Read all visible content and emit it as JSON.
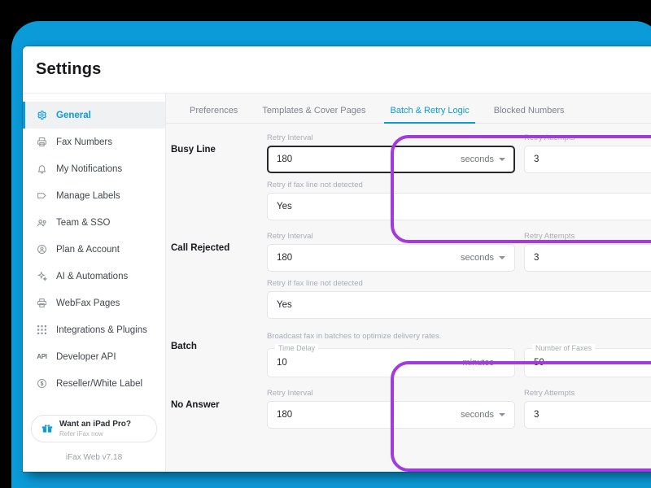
{
  "window": {
    "title": "Settings"
  },
  "sidebar": {
    "items": [
      {
        "label": "General",
        "icon": "gear-icon",
        "active": true
      },
      {
        "label": "Fax Numbers",
        "icon": "fax-icon",
        "active": false
      },
      {
        "label": "My Notifications",
        "icon": "bell-icon",
        "active": false
      },
      {
        "label": "Manage Labels",
        "icon": "tag-icon",
        "active": false
      },
      {
        "label": "Team & SSO",
        "icon": "people-icon",
        "active": false
      },
      {
        "label": "Plan & Account",
        "icon": "user-circle-icon",
        "active": false
      },
      {
        "label": "AI & Automations",
        "icon": "sparkle-icon",
        "active": false
      },
      {
        "label": "WebFax Pages",
        "icon": "printer-icon",
        "active": false
      },
      {
        "label": "Integrations & Plugins",
        "icon": "grid-dots-icon",
        "active": false
      },
      {
        "label": "Developer API",
        "icon": "api-icon",
        "active": false
      },
      {
        "label": "Reseller/White Label",
        "icon": "dollar-circle-icon",
        "active": false
      }
    ],
    "promo": {
      "icon": "gift-icon",
      "title": "Want an iPad Pro?",
      "subtitle": "Refer iFax now"
    },
    "version": "iFax Web v7.18"
  },
  "tabs": [
    {
      "label": "Preferences",
      "active": false
    },
    {
      "label": "Templates & Cover Pages",
      "active": false
    },
    {
      "label": "Batch & Retry Logic",
      "active": true
    },
    {
      "label": "Blocked Numbers",
      "active": false
    }
  ],
  "sections": {
    "busy_line": {
      "label": "Busy Line",
      "retry_interval_label": "Retry Interval",
      "retry_interval_value": "180",
      "retry_interval_unit": "seconds",
      "retry_attempts_label": "Retry Attempts",
      "retry_attempts_value": "3",
      "fax_detect_label": "Retry if fax line not detected",
      "fax_detect_value": "Yes"
    },
    "call_rejected": {
      "label": "Call Rejected",
      "retry_interval_label": "Retry Interval",
      "retry_interval_value": "180",
      "retry_interval_unit": "seconds",
      "retry_attempts_label": "Retry Attempts",
      "retry_attempts_value": "3",
      "fax_detect_label": "Retry if fax line not detected",
      "fax_detect_value": "Yes"
    },
    "batch": {
      "label": "Batch",
      "helper": "Broadcast fax in batches to optimize delivery rates.",
      "time_delay_label": "Time Delay",
      "time_delay_value": "10",
      "time_delay_unit": "minutes",
      "number_of_faxes_label": "Number of Faxes",
      "number_of_faxes_value": "50"
    },
    "no_answer": {
      "label": "No Answer",
      "retry_interval_label": "Retry Interval",
      "retry_interval_value": "180",
      "retry_interval_unit": "seconds",
      "retry_attempts_label": "Retry Attempts",
      "retry_attempts_value": "3"
    }
  },
  "colors": {
    "brand_blue": "#0b9bd8",
    "highlight_purple": "#a23ae0",
    "frame_black": "#000000"
  }
}
